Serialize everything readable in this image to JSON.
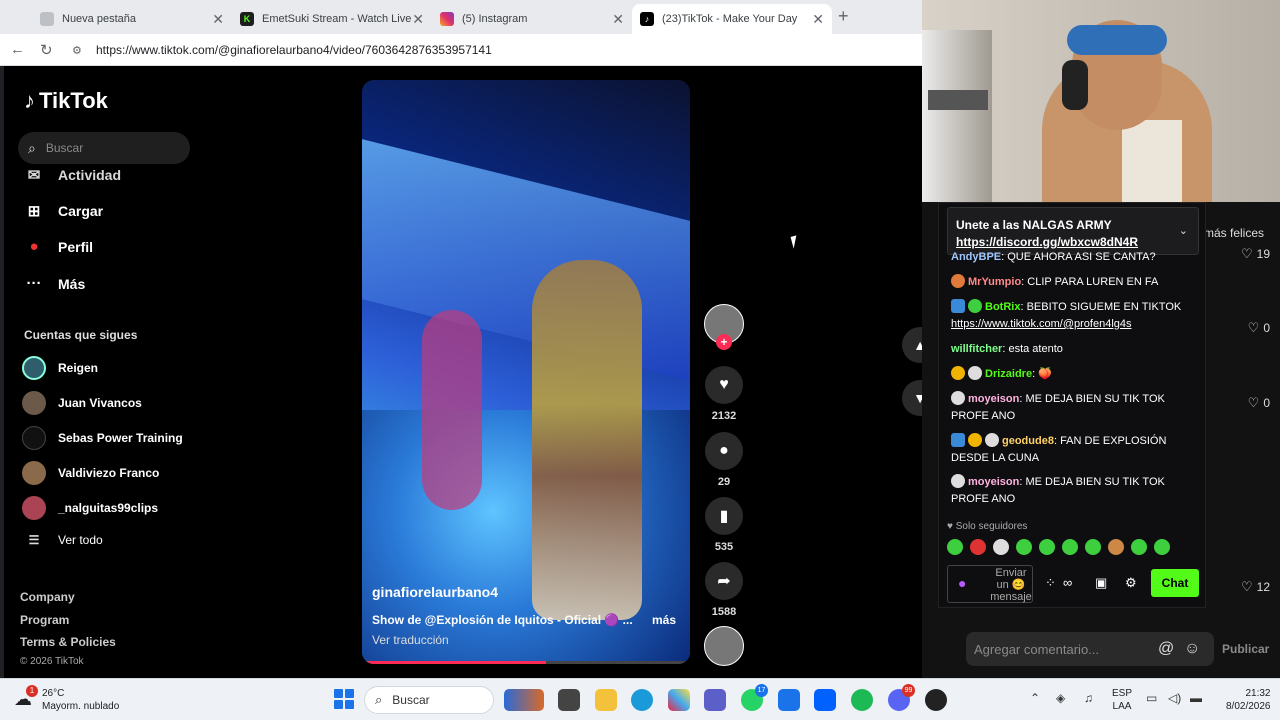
{
  "browser": {
    "tabs": [
      {
        "label": "Nueva pestaña",
        "active": false
      },
      {
        "label": "EmetSuki Stream - Watch Live on K",
        "active": false
      },
      {
        "label": "(5) Instagram",
        "active": false
      },
      {
        "label": "(23)TikTok - Make Your Day",
        "active": true
      }
    ],
    "new_tab_label": "+",
    "url": "https://www.tiktok.com/@ginafiorelaurbano4/video/7603642876353957141"
  },
  "tiktok": {
    "logo": "TikTok",
    "search_placeholder": "Buscar",
    "nav": [
      {
        "label": "Actividad",
        "icon": "activity-icon"
      },
      {
        "label": "Cargar",
        "icon": "upload-icon"
      },
      {
        "label": "Perfil",
        "icon": "profile-icon"
      },
      {
        "label": "Más",
        "icon": "more-icon"
      }
    ],
    "following_title": "Cuentas que sigues",
    "following": [
      {
        "name": "Reigen"
      },
      {
        "name": "Juan Vivancos"
      },
      {
        "name": "Sebas Power Training"
      },
      {
        "name": "Valdiviezo Franco"
      },
      {
        "name": "_nalguitas99clips"
      }
    ],
    "see_all": "Ver todo",
    "footer": [
      "Company",
      "Program",
      "Terms & Policies"
    ],
    "copyright": "© 2026 TikTok",
    "video": {
      "username": "ginafiorelaurbano4",
      "description": "Show de @Explosión de Iquitos - Oficial 🟣 ...",
      "more": "más",
      "translate": "Ver traducción",
      "progress": 0.56
    },
    "actions": {
      "likes": "2132",
      "comments": "29",
      "saves": "535",
      "shares": "1588"
    },
    "comments_panel": {
      "side_text": "más felices",
      "counts": [
        "19",
        "0",
        "0",
        "12"
      ],
      "add_comment_placeholder": "Agregar comentario...",
      "publish": "Publicar"
    }
  },
  "chat": {
    "pinned_line1": "Unete a las NALGAS ARMY",
    "pinned_line2": "https://discord.gg/wbxcw8dN4R",
    "messages": [
      {
        "user": "AndyBPE",
        "text": ": QUE AHORA ASI SE CANTA?",
        "color": "#9fc7ff"
      },
      {
        "user": "MrYumpio",
        "text": ": CLIP PARA LUREN EN FA",
        "color": "#ff8a8a"
      },
      {
        "user": "BotRix",
        "text": ": BEBITO SIGUEME EN TIKTOK",
        "link": "https://www.tiktok.com/@profen4lg4s",
        "color": "#53fc18"
      },
      {
        "user": "willfitcher",
        "text": ": esta atento",
        "color": "#7dff8a"
      },
      {
        "user": "Drizaidre",
        "text": ": 🍑",
        "color": "#53fc18"
      },
      {
        "user": "moyeison",
        "text": ": ME DEJA BIEN SU TIK TOK PROFE ANO",
        "color": "#ffb3e0"
      },
      {
        "user": "geodude8",
        "text": ": FAN DE EXPLOSIÓN DESDE LA CUNA",
        "color": "#ffd166"
      },
      {
        "user": "moyeison",
        "text": ": ME DEJA BIEN SU TIK TOK PROFE ANO",
        "color": "#ffb3e0"
      }
    ],
    "only_followers": "Solo seguidores",
    "send_placeholder": "Enviar un 😊 mensaje",
    "chat_button": "Chat"
  },
  "taskbar": {
    "weather_temp": "26°C",
    "weather_desc": "Mayorm. nublado",
    "weather_badge": "1",
    "search_label": "Buscar",
    "whatsapp_badge": "17",
    "discord_badge": "99",
    "lang1": "ESP",
    "lang2": "LAA",
    "time": "21:32",
    "date": "8/02/2026"
  }
}
